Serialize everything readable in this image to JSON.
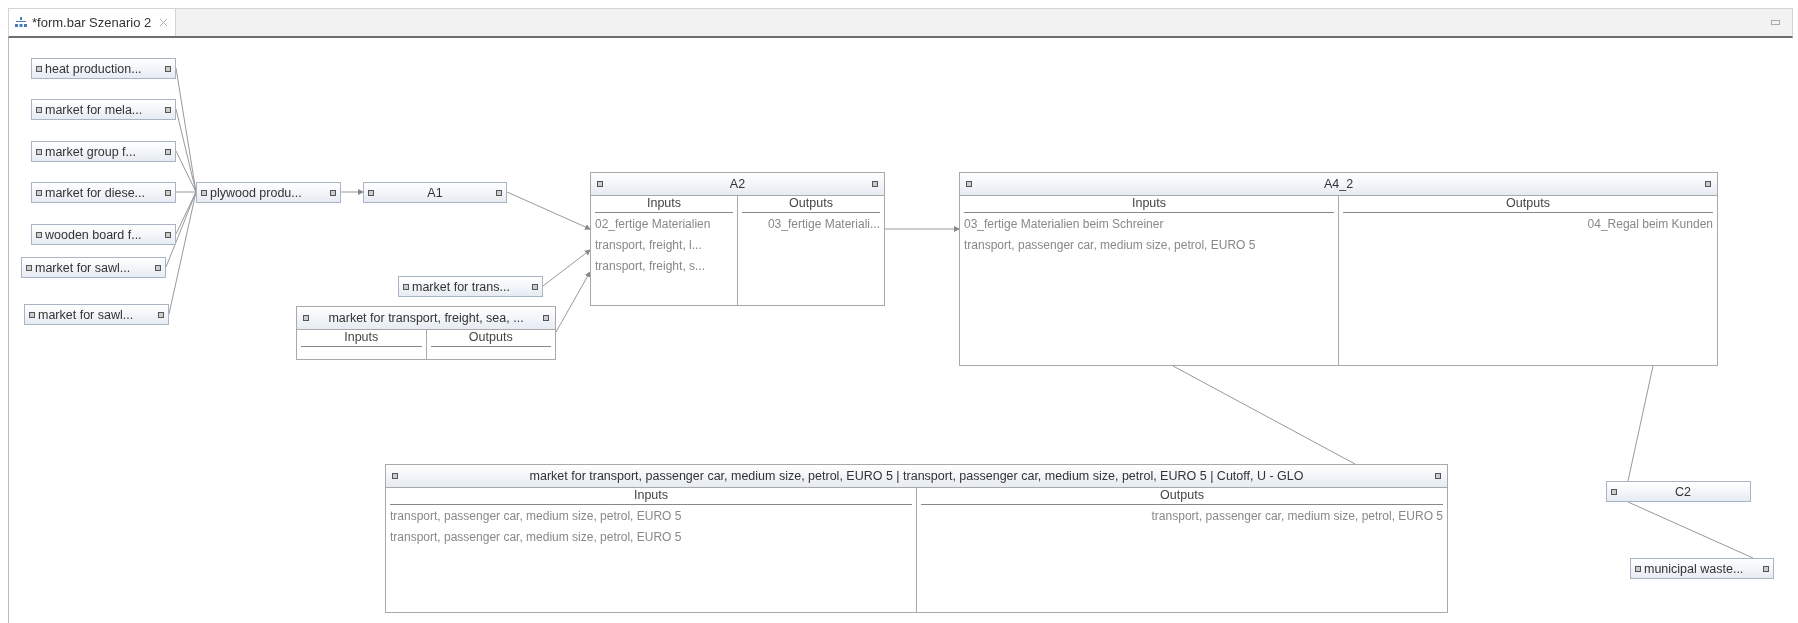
{
  "tab": {
    "title": "*form.bar Szenario 2"
  },
  "nodes": [
    {
      "kind": "provider",
      "label": "heat production...",
      "output_port": true
    },
    {
      "kind": "provider",
      "label": "market for mela...",
      "output_port": true
    },
    {
      "kind": "provider",
      "label": "market group f...",
      "output_port": true
    },
    {
      "kind": "provider",
      "label": "market for diese...",
      "output_port": true
    },
    {
      "kind": "provider",
      "label": "wooden board f...",
      "output_port": true
    },
    {
      "kind": "provider",
      "label": "market for sawl...",
      "output_port": true
    },
    {
      "kind": "provider",
      "label": "market for sawl...",
      "output_port": true
    },
    {
      "kind": "provider",
      "label": "plywood produ...",
      "output_port": true
    },
    {
      "kind": "process",
      "label": "A1",
      "output_port": true
    },
    {
      "kind": "provider",
      "label": "market for trans...",
      "output_port": true
    },
    {
      "kind": "table",
      "title": "market for transport, freight, sea, ...",
      "columns": [
        "Inputs",
        "Outputs"
      ]
    },
    {
      "kind": "table",
      "title": "A2",
      "columns": [
        "Inputs",
        "Outputs"
      ],
      "inputs": [
        "02_fertige Materialien",
        "transport, freight, l...",
        "transport, freight, s..."
      ],
      "outputs": [
        "03_fertige Materiali..."
      ]
    },
    {
      "kind": "table",
      "title": "A4_2",
      "columns": [
        "Inputs",
        "Outputs"
      ],
      "inputs": [
        "03_fertige Materialien beim Schreiner",
        "transport, passenger car, medium size, petrol, EURO 5"
      ],
      "outputs": [
        "04_Regal beim Kunden"
      ]
    },
    {
      "kind": "table",
      "title": "market for transport, passenger car, medium size, petrol, EURO 5 | transport, passenger car, medium size, petrol, EURO 5 | Cutoff, U - GLO",
      "columns": [
        "Inputs",
        "Outputs"
      ],
      "inputs": [
        "transport, passenger car, medium size, petrol, EURO 5",
        "transport, passenger car, medium size, petrol, EURO 5"
      ],
      "outputs": [
        "transport, passenger car, medium size, petrol, EURO 5"
      ]
    },
    {
      "kind": "process",
      "label": "C2",
      "output_port": false
    },
    {
      "kind": "provider",
      "label": "municipal waste...",
      "output_port": true
    }
  ]
}
